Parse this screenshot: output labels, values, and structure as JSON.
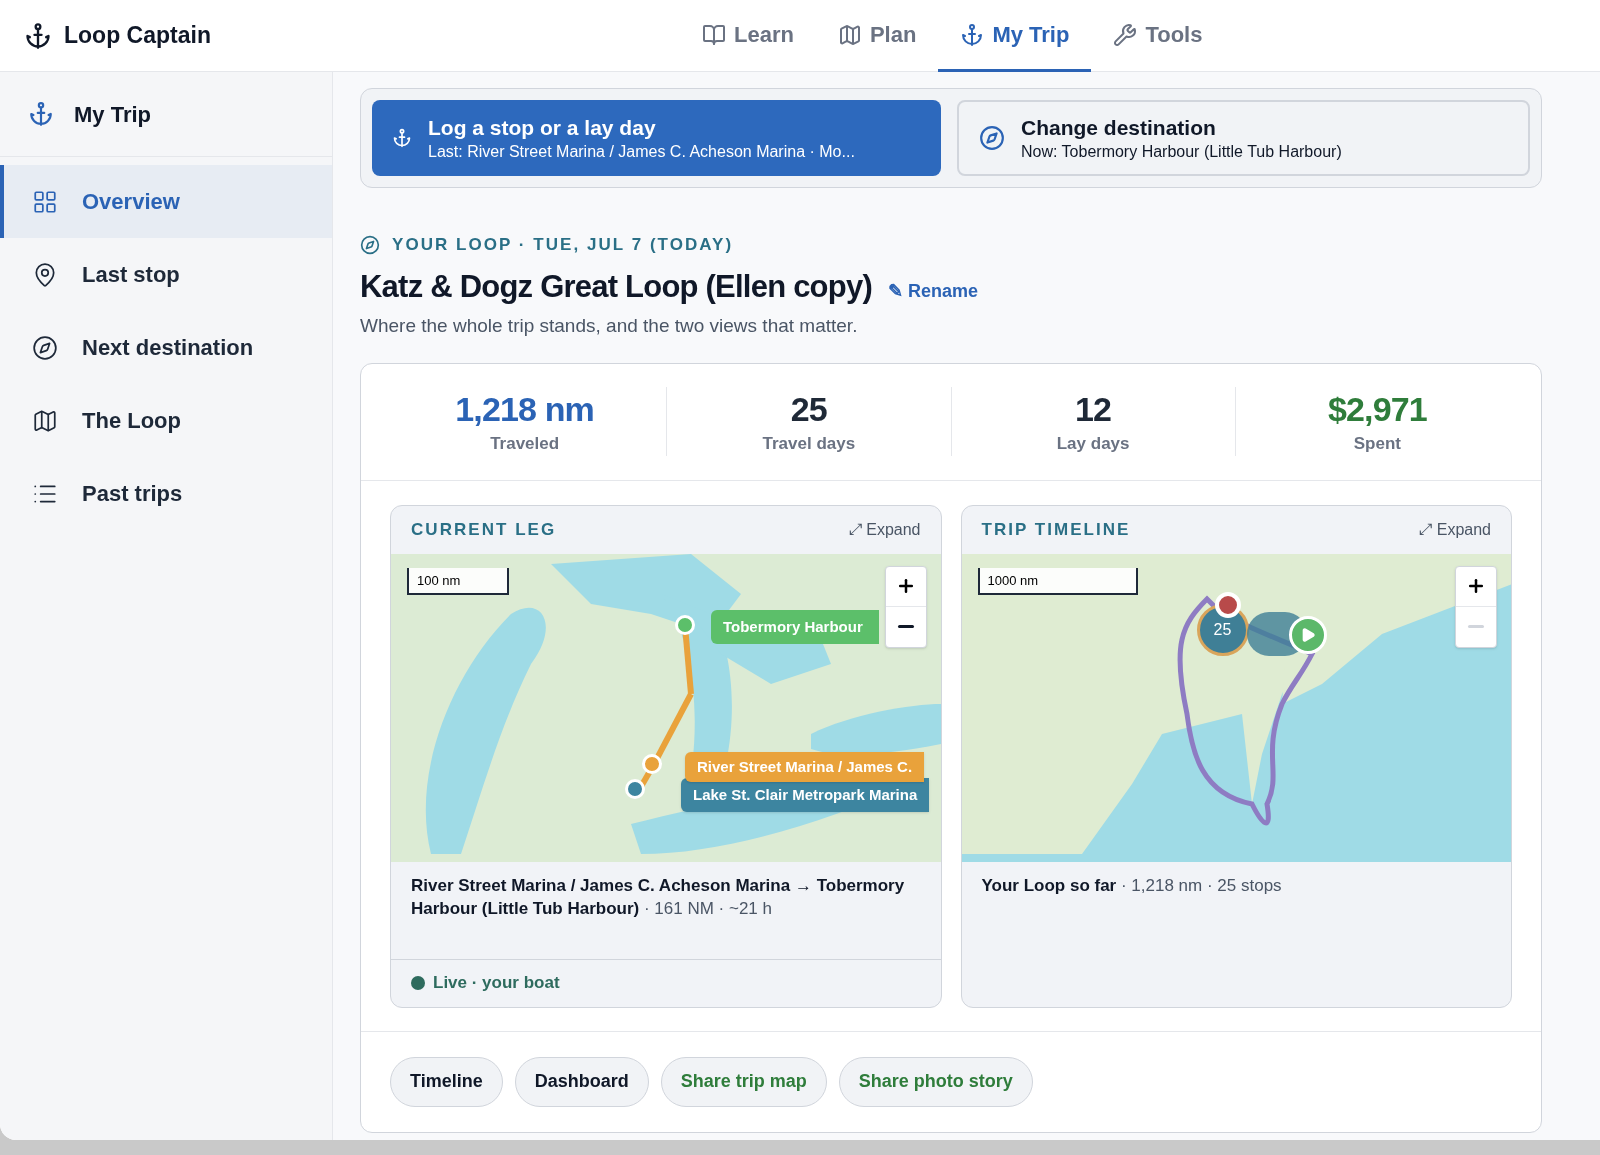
{
  "app": {
    "title": "Loop Captain"
  },
  "top_nav": [
    {
      "label": "Learn",
      "selected": false
    },
    {
      "label": "Plan",
      "selected": false
    },
    {
      "label": "My Trip",
      "selected": true
    },
    {
      "label": "Tools",
      "selected": false
    }
  ],
  "sidebar": {
    "title": "My Trip",
    "items": [
      {
        "label": "Overview",
        "selected": true
      },
      {
        "label": "Last stop",
        "selected": false
      },
      {
        "label": "Next destination",
        "selected": false
      },
      {
        "label": "The Loop",
        "selected": false
      },
      {
        "label": "Past trips",
        "selected": false
      }
    ]
  },
  "actions": [
    {
      "kind": "primary",
      "title": "Log a stop or a lay day",
      "subtitle": "Last: River Street Marina / James C. Acheson Marina · Mo..."
    },
    {
      "kind": "secondary",
      "title": "Change destination",
      "subtitle": "Now: Tobermory Harbour (Little Tub Harbour)"
    }
  ],
  "header": {
    "eyebrow": "YOUR LOOP · TUE, JUL 7 (TODAY)",
    "title": "Katz & Dogz Great Loop (Ellen copy)",
    "rename": "✎ Rename",
    "subtitle": "Where the whole trip stands, and the two views that matter."
  },
  "stats": [
    {
      "value": "1,218 nm",
      "label": "Traveled",
      "color": "#2b63b5"
    },
    {
      "value": "25",
      "label": "Travel days",
      "color": "#1f2937"
    },
    {
      "value": "12",
      "label": "Lay days",
      "color": "#1f2937"
    },
    {
      "value": "$2,971",
      "label": "Spent",
      "color": "#2f7d3b"
    }
  ],
  "current_leg": {
    "title": "CURRENT LEG",
    "expand": "⤢ Expand",
    "scale": "100 nm",
    "markers": [
      {
        "label": "Tobermory Harbour",
        "color": "#5cbf6a"
      },
      {
        "label": "River Street Marina / James C.",
        "color": "#e9a23b"
      },
      {
        "label": "Lake St. Clair Metropark Marina",
        "color": "#3d85a0"
      }
    ],
    "caption": "River Street Marina / James C. Acheson Marina → Tobermory Harbour (Little Tub Harbour)",
    "caption_meta": " · 161 NM · ~21 h",
    "footer": "Live · your boat"
  },
  "trip_timeline": {
    "title": "TRIP TIMELINE",
    "expand": "⤢ Expand",
    "scale": "1000 nm",
    "cluster": "25",
    "caption": "Your Loop so far",
    "caption_meta": " · 1,218 nm · 25 stops"
  },
  "buttons": [
    {
      "label": "Timeline",
      "kind": "plain"
    },
    {
      "label": "Dashboard",
      "kind": "plain"
    },
    {
      "label": "Share trip map",
      "kind": "share"
    },
    {
      "label": "Share photo story",
      "kind": "share"
    }
  ]
}
